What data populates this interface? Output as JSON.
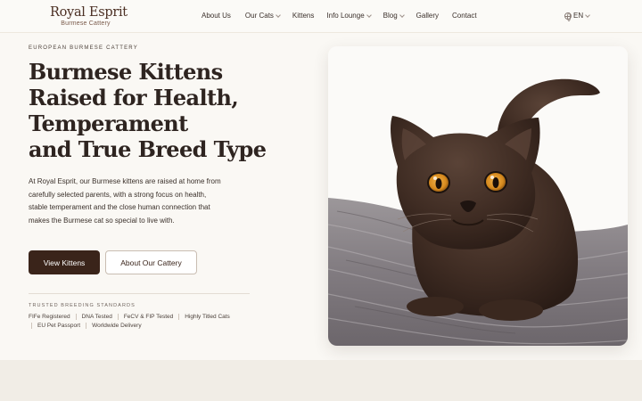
{
  "brand": {
    "name": "Royal Esprit",
    "tagline": "Burmese Cattery"
  },
  "nav": {
    "items": [
      {
        "label": "About Us",
        "dropdown": false
      },
      {
        "label": "Our Cats",
        "dropdown": true
      },
      {
        "label": "Kittens",
        "dropdown": false
      },
      {
        "label": "Info Lounge",
        "dropdown": true
      },
      {
        "label": "Blog",
        "dropdown": true
      },
      {
        "label": "Gallery",
        "dropdown": false
      },
      {
        "label": "Contact",
        "dropdown": false
      }
    ],
    "language": "EN"
  },
  "hero": {
    "eyebrow": "EUROPEAN BURMESE CATTERY",
    "headline_lines": [
      "Burmese Kittens",
      "Raised for Health,",
      "Temperament",
      "and True Breed Type"
    ],
    "intro": "At Royal Esprit, our Burmese kittens are raised at home from carefully selected parents, with a strong focus on health, stable temperament and the close human connection that makes the Burmese cat so special to live with.",
    "primary_button": "View Kittens",
    "secondary_button": "About Our Cattery",
    "trusted_title": "TRUSTED BREEDING STANDARDS",
    "badges": [
      "FIFe Registered",
      "DNA Tested",
      "FeCV & FIP Tested",
      "Highly Titled Cats",
      "EU Pet Passport",
      "Worldwide Delivery"
    ]
  },
  "icons": {
    "language": "globe-icon",
    "dropdown": "chevron-down-icon"
  },
  "colors": {
    "accent": "#3a241a",
    "background": "#faf8f4",
    "brand_text": "#4b2f23"
  }
}
